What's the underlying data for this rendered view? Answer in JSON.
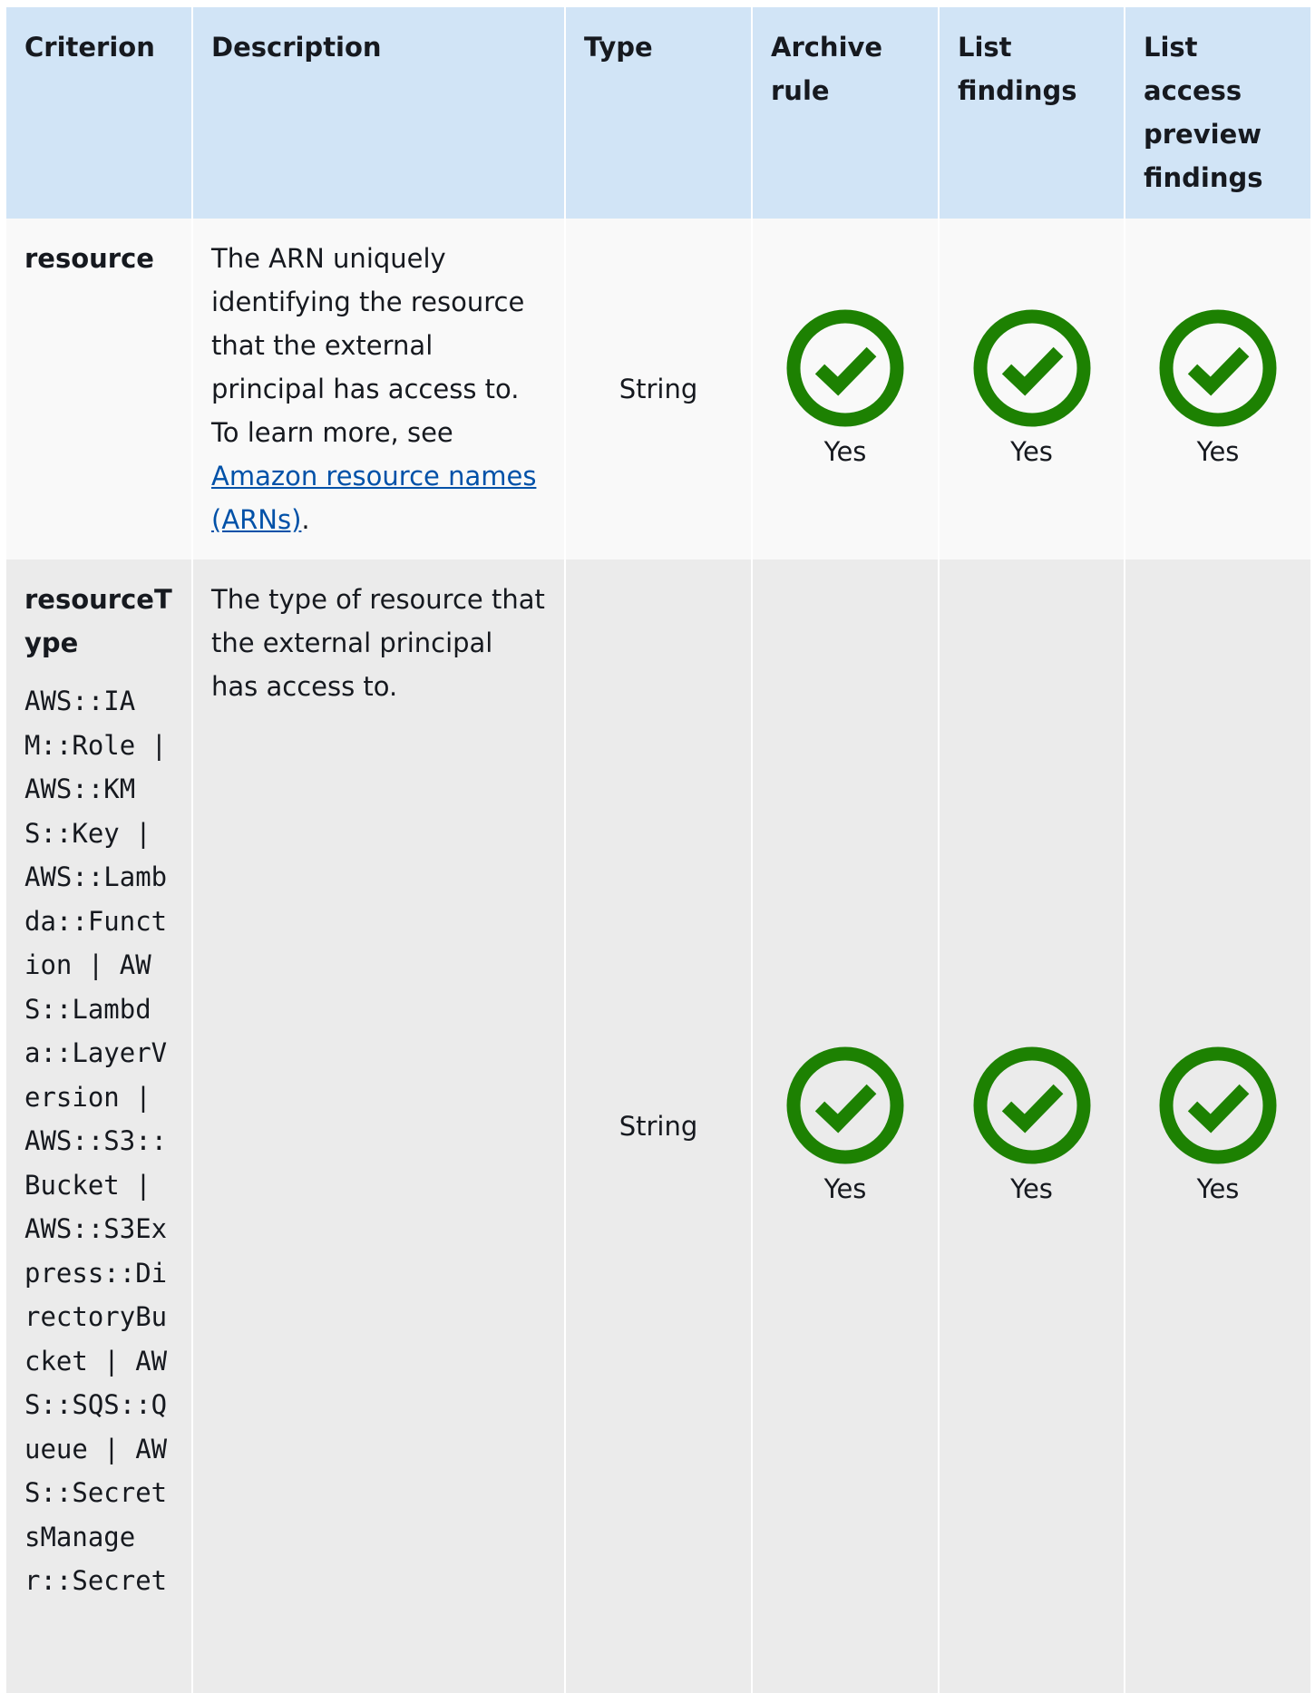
{
  "table": {
    "headers": [
      "Criterion",
      "Description",
      "Type",
      "Archive rule",
      "List findings",
      "List access preview findings"
    ],
    "rows": [
      {
        "criterion": "resource",
        "description_pre": "The ARN uniquely identifying the resource that the external principal has access to. To learn more, see ",
        "description_link": "Amazon resource names (ARNs)",
        "description_post": ".",
        "type": "String",
        "archive_rule": "Yes",
        "list_findings": "Yes",
        "list_access_preview_findings": "Yes"
      },
      {
        "criterion": "resourceType",
        "values": "AWS::IAM::Role | AWS::KMS::Key | AWS::Lambda::Function | AWS::Lambda::LayerVersion | AWS::S3::Bucket | AWS::S3Express::DirectoryBucket | AWS::SQS::Queue | AWS::SecretsManager::Secret",
        "description_pre": "The type of resource that the external principal has access to.",
        "type": "String",
        "archive_rule": "Yes",
        "list_findings": "Yes",
        "list_access_preview_findings": "Yes"
      }
    ]
  },
  "icons": {
    "check": "check-circle-icon",
    "check_color": "#1d8102"
  }
}
